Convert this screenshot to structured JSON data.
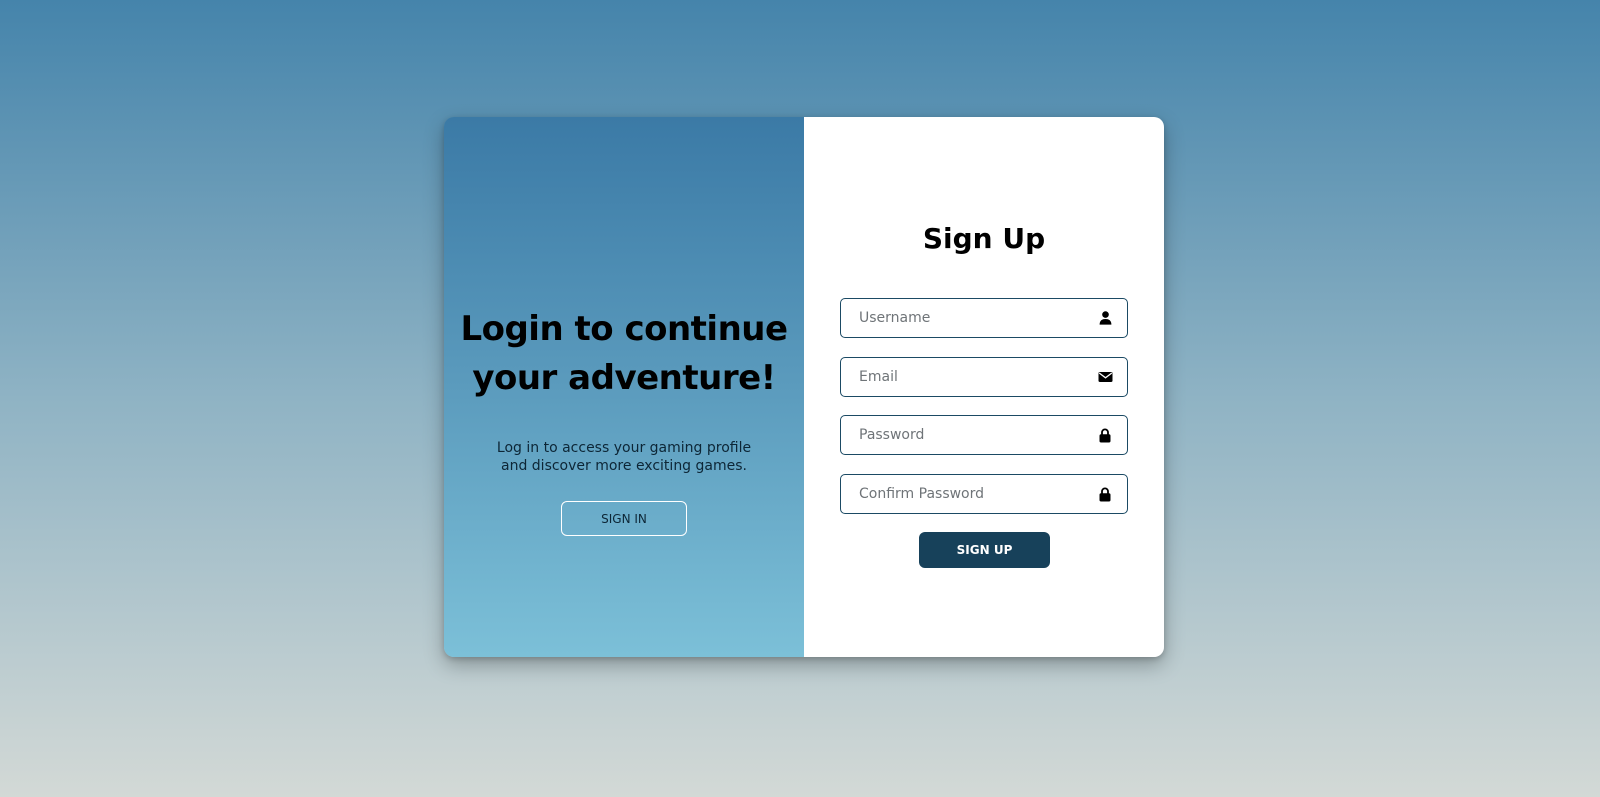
{
  "colors": {
    "background_top": "#4584ab",
    "background_bottom": "#d3d9d6",
    "left_panel_top": "#3b7aa6",
    "left_panel_bottom": "#7cc0d8",
    "primary_button": "#17415a",
    "field_border": "#1b4a64"
  },
  "left_panel": {
    "title": "Login to continue your adventure!",
    "subtitle": "Log in to access your gaming profile and discover more exciting games.",
    "signin_label": "SIGN IN"
  },
  "form": {
    "title": "Sign Up",
    "fields": [
      {
        "placeholder": "Username",
        "icon": "user-icon"
      },
      {
        "placeholder": "Email",
        "icon": "envelope-icon"
      },
      {
        "placeholder": "Password",
        "icon": "lock-icon"
      },
      {
        "placeholder": "Confirm Password",
        "icon": "lock-icon"
      }
    ],
    "signup_label": "SIGN UP"
  }
}
